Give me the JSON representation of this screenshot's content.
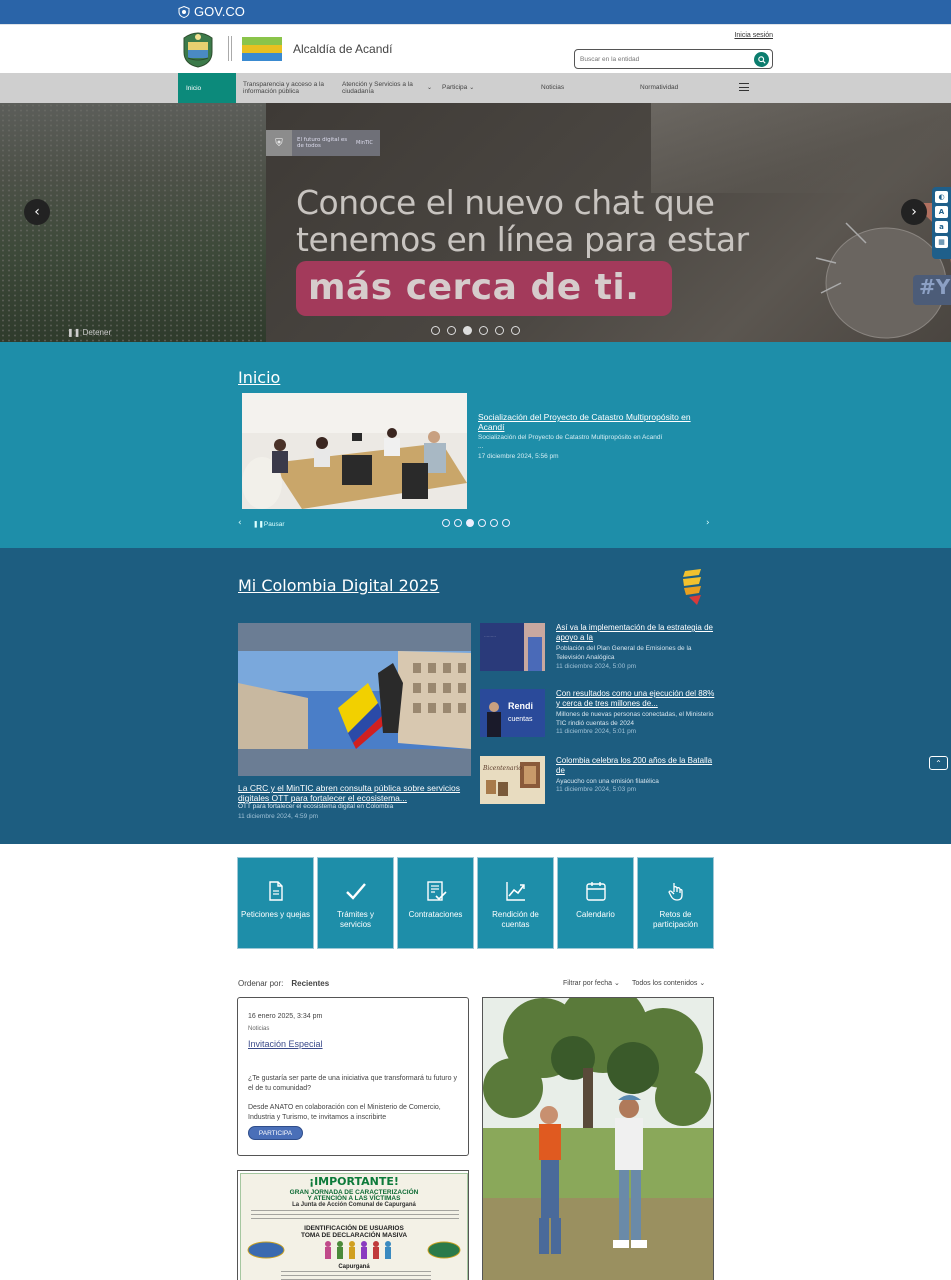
{
  "gov_bar": {
    "logo_text": "GOV.CO"
  },
  "header": {
    "site_name": "Alcaldía de Acandí",
    "login_label": "Inicia sesión",
    "search_placeholder": "Buscar en la entidad"
  },
  "nav": {
    "items": [
      {
        "label": "Inicio"
      },
      {
        "label": "Transparencia y acceso a la información pública"
      },
      {
        "label": "Atención y Servicios a la ciudadanía"
      },
      {
        "label": "Participa"
      },
      {
        "label": "Noticias"
      },
      {
        "label": "Normatividad"
      }
    ]
  },
  "hero": {
    "badge_text": "El futuro digital es de todos",
    "badge_brand": "MinTIC",
    "headline_line1": "Conoce el nuevo chat que",
    "headline_line2": "tenemos en línea para estar",
    "headline_highlight": "más cerca de ti.",
    "hashtag": "#Y",
    "stop_label": "Detener",
    "slide_count": 6,
    "active_slide": 3
  },
  "inicio": {
    "heading": "Inicio",
    "news_title": "Socialización del Proyecto de Catastro Multipropósito en Acandí",
    "news_summary": "Socialización del Proyecto de Catastro Multipropósito en Acandí",
    "news_ellipsis": "...",
    "news_date": "17 diciembre 2024, 5:56 pm",
    "pause_label": "Pausar",
    "slide_count": 6,
    "active_slide": 3
  },
  "mcd": {
    "heading": "Mi Colombia Digital 2025",
    "main": {
      "title": "La CRC y el MinTIC abren consulta pública sobre servicios digitales OTT para fortalecer el ecosistema...",
      "summary": "OTT para fortalecer el ecosistema digital en Colombia",
      "date": "11 diciembre 2024, 4:59 pm"
    },
    "side": [
      {
        "title": "Así va la implementación de la estrategia de apoyo a la",
        "summary": "Población del Plan General de Emisiones de la Televisión Analógica",
        "date": "11 diciembre 2024, 5:00 pm"
      },
      {
        "title": "Con resultados como una ejecución del 88% y cerca de tres millones de...",
        "summary": "Millones de nuevas personas conectadas, el Ministerio TIC rindió cuentas de 2024",
        "date": "11 diciembre 2024, 5:01 pm"
      },
      {
        "title": "Colombia celebra los 200 años de la Batalla de",
        "summary": "Ayacucho con una emisión filatélica",
        "date": "11 diciembre 2024, 5:03 pm"
      }
    ],
    "thumb2_text": "Rendición de cuentas",
    "thumb3_text": "Bicentenario"
  },
  "tiles": [
    {
      "label": "Peticiones y quejas",
      "icon": "document-icon"
    },
    {
      "label": "Trámites y servicios",
      "icon": "check-icon"
    },
    {
      "label": "Contrataciones",
      "icon": "contract-icon"
    },
    {
      "label": "Rendición de cuentas",
      "icon": "chart-icon"
    },
    {
      "label": "Calendario",
      "icon": "calendar-icon"
    },
    {
      "label": "Retos de participación",
      "icon": "hand-icon"
    }
  ],
  "filters": {
    "order_label": "Ordenar por:",
    "order_value": "Recientes",
    "date_filter": "Filtrar por fecha",
    "content_filter": "Todos los contenidos"
  },
  "card1": {
    "date": "16 enero 2025, 3:34 pm",
    "category": "Noticias",
    "title": "Invitación Especial",
    "p1": "¿Te gustaría ser parte de una iniciativa que transformará tu futuro y el de tu comunidad?",
    "p2": "Desde ANATO en colaboración con el Ministerio de Comercio, Industria y Turismo, te invitamos a inscribirte",
    "button": "PARTICIPA"
  },
  "card2": {
    "title": "¡IMPORTANTE!",
    "l1": "GRAN JORNADA DE CARACTERIZACIÓN",
    "l2": "Y ATENCIÓN A LAS VÍCTIMAS",
    "l3": "La Junta de Acción Comunal de Capurganá",
    "l4": "IDENTIFICACIÓN DE USUARIOS",
    "l5": "TOMA DE DECLARACIÓN MASIVA",
    "l6": "Capurganá"
  },
  "colors": {
    "gov_blue": "#2a64a8",
    "nav_active": "#0c8a7b",
    "inicio_bg": "#1e8ea9",
    "mcd_bg": "#1d5d80",
    "tile_bg": "#1e8ea9"
  }
}
